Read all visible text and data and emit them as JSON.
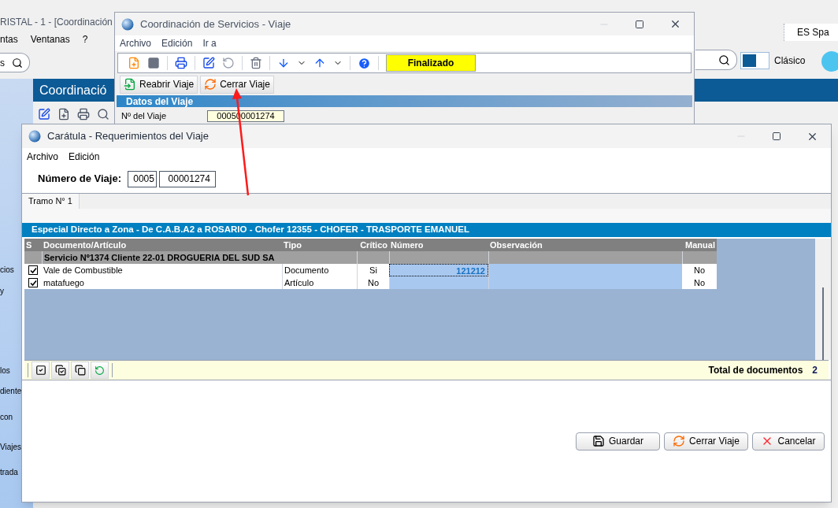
{
  "background_app": {
    "title": "RISTAL - 1 - [Coordinación",
    "menu": [
      "ntas",
      "Ventanas",
      "?"
    ],
    "search_field": {
      "value": "s"
    },
    "header": "Coordinació",
    "sidebar_items": [
      "cios",
      "y",
      "los",
      "diente",
      "con",
      "Viajes",
      "trada"
    ],
    "language": "ES Spa",
    "theme_label": "Clásico"
  },
  "trip_window": {
    "title": "Coordinación de Servicios - Viaje",
    "menu": [
      "Archivo",
      "Edición",
      "Ir a"
    ],
    "status": "Finalizado",
    "actions": [
      {
        "kind": "reopen",
        "label": "Reabrir Viaje"
      },
      {
        "kind": "close-trip",
        "label": "Cerrar Viaje"
      }
    ],
    "section": "Datos del Viaje",
    "fields": [
      {
        "label": "Nº del Viaje",
        "value": "000500001274"
      }
    ]
  },
  "requirements_window": {
    "title": "Carátula - Requerimientos del Viaje",
    "menu": [
      "Archivo",
      "Edición"
    ],
    "trip_number": {
      "label": "Número de Viaje:",
      "prefix": "0005",
      "number": "00001274"
    },
    "tabs": [
      {
        "label": "Tramo N° 1",
        "selected": true
      }
    ],
    "route": "Especial Directo a Zona - De C.A.B.A2 a ROSARIO - Chofer 12355 - CHOFER - TRASPORTE EMANUEL",
    "table": {
      "columns": [
        "S",
        "Documento/Artículo",
        "Tipo",
        "Crítico",
        "Número",
        "Observación",
        "Manual"
      ],
      "group": "Servicio Nº1374 Cliente 22-01 DROGUERIA DEL SUD SA",
      "rows": [
        {
          "checked": true,
          "selected": true,
          "document": "Vale de Combustible",
          "type": "Documento",
          "critical": "Si",
          "number": "121212",
          "manual": "No"
        },
        {
          "checked": true,
          "selected": false,
          "document": "matafuego",
          "type": "Artículo",
          "critical": "No",
          "manual": "No"
        }
      ]
    },
    "total": {
      "label": "Total de documentos",
      "value": "2"
    },
    "buttons": [
      {
        "kind": "save",
        "label": "Guardar"
      },
      {
        "kind": "close-trip",
        "label": "Cerrar Viaje"
      },
      {
        "kind": "cancel",
        "label": "Cancelar"
      }
    ]
  }
}
